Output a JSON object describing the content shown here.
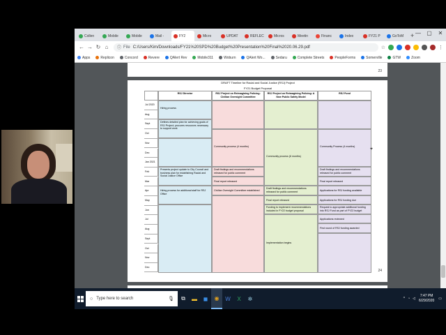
{
  "browser": {
    "tabs": [
      {
        "label": "Collen",
        "color": "#34a853",
        "active": false
      },
      {
        "label": "Mobile",
        "color": "#34a853",
        "active": false
      },
      {
        "label": "Mobile",
        "color": "#34a853",
        "active": false
      },
      {
        "label": "Mail -",
        "color": "#1a73e8",
        "active": false
      },
      {
        "label": "FY2",
        "color": "#d93025",
        "active": true
      },
      {
        "label": "Micro",
        "color": "#d93025",
        "active": false
      },
      {
        "label": "UPDAT",
        "color": "#d93025",
        "active": false
      },
      {
        "label": "REFLEC",
        "color": "#d93025",
        "active": false
      },
      {
        "label": "Micros",
        "color": "#d93025",
        "active": false
      },
      {
        "label": "Meetin",
        "color": "#d93025",
        "active": false
      },
      {
        "label": "Financ",
        "color": "#ea4335",
        "active": false
      },
      {
        "label": "Index",
        "color": "#1a73e8",
        "active": false
      },
      {
        "label": "FY21 P",
        "color": "#d93025",
        "active": false
      },
      {
        "label": "GoToM",
        "color": "#1a73e8",
        "active": false
      }
    ],
    "new_tab": "+",
    "window_controls": {
      "minimize": "—",
      "maximize": "▢",
      "close": "✕"
    },
    "address": {
      "scheme": "File",
      "url": "C:/Users/Kim/Downloads/FY21%20SPD%20Budget%20Presentation%20Final%2020.06.29.pdf"
    },
    "bookmarks": [
      "Apps",
      "Replicon",
      "Concord",
      "Revere",
      "QAlert Rev",
      "Mobile311",
      "Woburn",
      "QAlert Wo...",
      "Sedaru",
      "Complete Streets",
      "PeopleForms",
      "Somerville",
      "GTW",
      "Zoom"
    ]
  },
  "pdf": {
    "prev_page_number": "23",
    "page_number": "24",
    "table": {
      "title": "DRAFT Timeline for Racial and Social Justice (RSJ) Project",
      "subtitle": "FY21 Budget Proposal",
      "headers": [
        "",
        "RSJ Director",
        "RSJ Project on Reimagining Policing: Civilian Oversight Committee",
        "RSJ Project on Reimagining Policing: A New Public Safety Model",
        "RSJ Fund"
      ],
      "months": [
        "Jul 2020",
        "Aug",
        "Sept",
        "Oct",
        "Nov",
        "Dec",
        "Jan 2021",
        "Feb",
        "Mar",
        "Apr",
        "May",
        "Jun",
        "Jul",
        "Aug",
        "Sept",
        "Oct",
        "Nov",
        "Dec"
      ],
      "director": {
        "hiring": "Hiring process",
        "defines": "Defines detailed plan for achieving goals of RSJ Project; procures resources necessary to support work",
        "presents": "Presents project update to City Council and business plan for establishing Racial and Social Justice Office",
        "additional": "Hiring process for additional staff for RSJ Office"
      },
      "civilian": {
        "community": "Community process (4 months)",
        "draft": "Draft findings and recommendations released for public comment",
        "final": "Final report released",
        "established": "Civilian Oversight Committee established"
      },
      "safety": {
        "community": "Community process (6 months)",
        "draft": "Draft findings and recommendations released for public comment",
        "final": "Final report released",
        "funding": "Funding to implement recommendations included in FY22 budget proposal",
        "implementation": "Implementation begins"
      },
      "fund": {
        "community": "Community Process (4 months)",
        "draft": "Draft findings and recommendations released for public comment",
        "final": "Final report released",
        "applications_available": "Applications for RSJ funding available",
        "applications_due": "Applications for RSJ funding due",
        "request": "Request to appropriate additional funding into RSJ Fund as part of FY22 budget",
        "reviewed": "Applications reviewed",
        "first_round": "First round of RSJ funding awarded"
      }
    }
  },
  "taskbar": {
    "search_placeholder": "Type here to search",
    "time": "7:47 PM",
    "date": "6/29/2020"
  },
  "colors": {
    "director": "#d9ecf4",
    "civilian": "#f8dcdc",
    "safety": "#e4efd0",
    "fund": "#e6e0f0",
    "taskbar": "#101c2c"
  }
}
